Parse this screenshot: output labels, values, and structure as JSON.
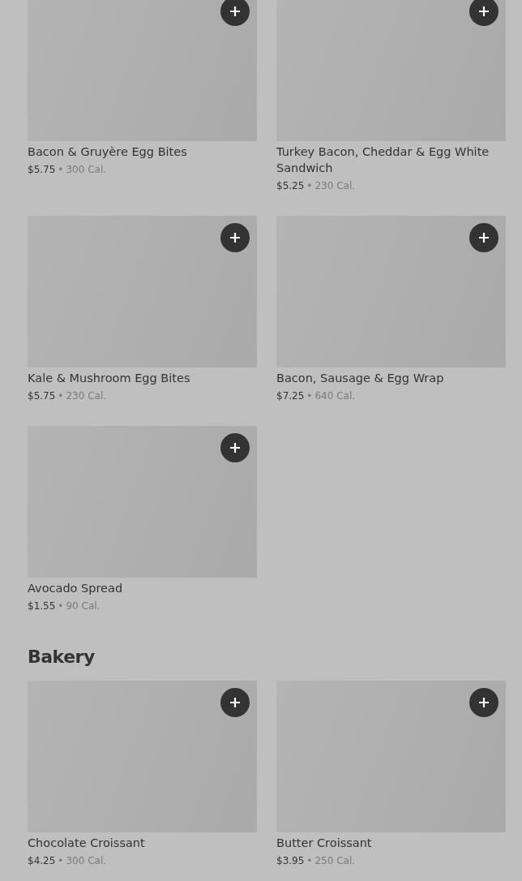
{
  "sections": [
    {
      "items": [
        {
          "name": "Bacon & Gruyère Egg Bites",
          "price": "$5.75",
          "separator": "•",
          "calories": "300 Cal."
        },
        {
          "name": "Turkey Bacon, Cheddar & Egg White Sandwich",
          "price": "$5.25",
          "separator": "•",
          "calories": "230 Cal."
        },
        {
          "name": "Kale & Mushroom Egg Bites",
          "price": "$5.75",
          "separator": "•",
          "calories": "230 Cal."
        },
        {
          "name": "Bacon, Sausage & Egg Wrap",
          "price": "$7.25",
          "separator": "•",
          "calories": "640 Cal."
        },
        {
          "name": "Avocado Spread",
          "price": "$1.55",
          "separator": "•",
          "calories": "90 Cal."
        }
      ]
    },
    {
      "title": "Bakery",
      "items": [
        {
          "name": "Chocolate Croissant",
          "price": "$4.25",
          "separator": "•",
          "calories": "300 Cal."
        },
        {
          "name": "Butter Croissant",
          "price": "$3.95",
          "separator": "•",
          "calories": "250 Cal."
        }
      ]
    }
  ]
}
